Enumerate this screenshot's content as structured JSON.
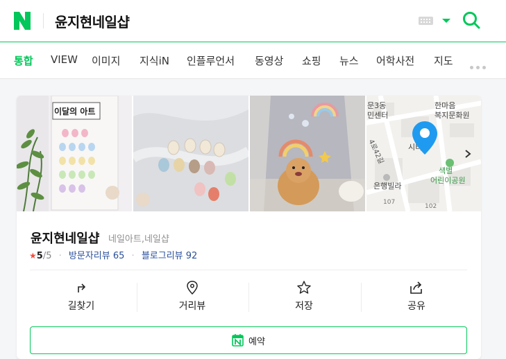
{
  "header": {
    "query": "윤지현네일샵"
  },
  "colors": {
    "brand": "#03c75a",
    "link": "#2a4f9b",
    "star": "#f44e3b"
  },
  "tabs": [
    {
      "label": "통합",
      "active": true
    },
    {
      "label": "VIEW"
    },
    {
      "label": "이미지"
    },
    {
      "label": "지식iN"
    },
    {
      "label": "인플루언서"
    },
    {
      "label": "동영상"
    },
    {
      "label": "쇼핑"
    },
    {
      "label": "뉴스"
    },
    {
      "label": "어학사전"
    },
    {
      "label": "지도"
    }
  ],
  "photos": {
    "p1_sign": "이달의 아트"
  },
  "map": {
    "labels": [
      "문3동",
      "민센터",
      "한마음",
      "복지문화원",
      "시티",
      "색별",
      "어린이공원",
      "은행빌라",
      "107",
      "102",
      "4로42길"
    ]
  },
  "place": {
    "name": "윤지현네일샵",
    "category": "네일아트,네일샵",
    "rating": "5",
    "rating_max": "/5",
    "visitor_review_label": "방문자리뷰",
    "visitor_review_count": "65",
    "blog_review_label": "블로그리뷰",
    "blog_review_count": "92"
  },
  "actions": [
    {
      "label": "길찾기",
      "icon": "directions-icon"
    },
    {
      "label": "거리뷰",
      "icon": "location-pin-icon"
    },
    {
      "label": "저장",
      "icon": "star-outline-icon"
    },
    {
      "label": "공유",
      "icon": "share-icon"
    }
  ],
  "reserve": {
    "label": "예약",
    "icon": "naver-booking-icon"
  }
}
